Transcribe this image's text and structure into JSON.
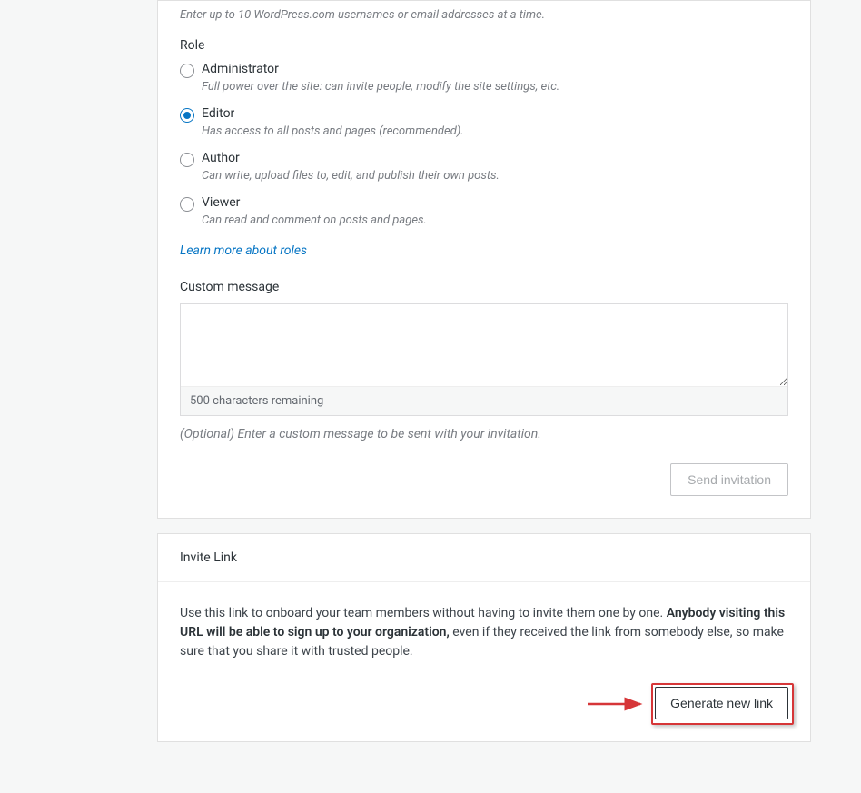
{
  "invite_form": {
    "username_hint": "Enter up to 10 WordPress.com usernames or email addresses at a time.",
    "role_label": "Role",
    "roles": [
      {
        "name": "Administrator",
        "desc": "Full power over the site: can invite people, modify the site settings, etc.",
        "checked": false
      },
      {
        "name": "Editor",
        "desc": "Has access to all posts and pages (recommended).",
        "checked": true
      },
      {
        "name": "Author",
        "desc": "Can write, upload files to, edit, and publish their own posts.",
        "checked": false
      },
      {
        "name": "Viewer",
        "desc": "Can read and comment on posts and pages.",
        "checked": false
      }
    ],
    "learn_more": "Learn more about roles",
    "custom_message_label": "Custom message",
    "custom_message_value": "",
    "char_remaining": "500 characters remaining",
    "optional_hint": "(Optional) Enter a custom message to be sent with your invitation.",
    "send_button": "Send invitation"
  },
  "invite_link": {
    "header": "Invite Link",
    "text_pre": "Use this link to onboard your team members without having to invite them one by one. ",
    "text_bold": "Anybody visiting this URL will be able to sign up to your organization,",
    "text_post": " even if they received the link from somebody else, so make sure that you share it with trusted people.",
    "generate_button": "Generate new link"
  }
}
